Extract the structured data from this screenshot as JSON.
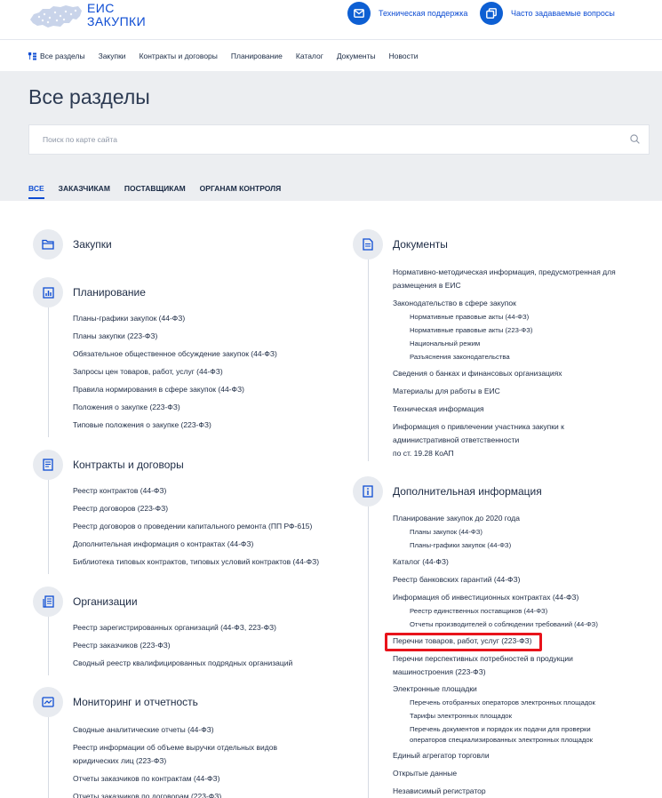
{
  "header": {
    "logo": [
      "ЕИС",
      "ЗАКУПКИ"
    ],
    "support_label": "Техническая поддержка",
    "faq_label": "Часто задаваемые вопросы"
  },
  "nav": [
    "Все разделы",
    "Закупки",
    "Контракты и договоры",
    "Планирование",
    "Каталог",
    "Документы",
    "Новости"
  ],
  "page_title": "Все разделы",
  "search": {
    "placeholder": "Поиск по карте сайта"
  },
  "tabs": [
    "ВСЕ",
    "ЗАКАЗЧИКАМ",
    "ПОСТАВЩИКАМ",
    "ОРГАНАМ КОНТРОЛЯ"
  ],
  "colors": {
    "accent": "#0d4cd3",
    "highlight": "#e8131b",
    "hero_bg": "#eceef1"
  },
  "left_sections": [
    {
      "title": "Закупки",
      "icon": "folder-icon",
      "items": []
    },
    {
      "title": "Планирование",
      "icon": "bar-chart-icon",
      "items": [
        {
          "text": "Планы-графики закупок (44-ФЗ)"
        },
        {
          "text": "Планы закупки (223-ФЗ)"
        },
        {
          "text": "Обязательное общественное обсуждение закупок (44-ФЗ)"
        },
        {
          "text": "Запросы цен товаров, работ, услуг (44-ФЗ)"
        },
        {
          "text": "Правила нормирования в сфере закупок (44-ФЗ)"
        },
        {
          "text": "Положения о закупке (223-ФЗ)"
        },
        {
          "text": "Типовые положения о закупке (223-ФЗ)"
        }
      ]
    },
    {
      "title": "Контракты и договоры",
      "icon": "document-icon",
      "items": [
        {
          "text": "Реестр контрактов (44-ФЗ)"
        },
        {
          "text": "Реестр договоров (223-ФЗ)"
        },
        {
          "text": "Реестр договоров о проведении капитального ремонта (ПП РФ-615)"
        },
        {
          "text": "Дополнительная информация о контрактах (44-ФЗ)"
        },
        {
          "text": "Библиотека типовых контрактов, типовых условий контрактов (44-ФЗ)"
        }
      ]
    },
    {
      "title": "Организации",
      "icon": "organization-icon",
      "items": [
        {
          "text": "Реестр зарегистрированных организаций (44-ФЗ, 223-ФЗ)"
        },
        {
          "text": "Реестр заказчиков (223-ФЗ)"
        },
        {
          "text": "Сводный реестр квалифицированных подрядных организаций"
        }
      ]
    },
    {
      "title": "Мониторинг и отчетность",
      "icon": "monitor-icon",
      "items": [
        {
          "text": "Сводные аналитические отчеты (44-ФЗ)"
        },
        {
          "text": "Реестр информации об объеме выручки отдельных видов"
        },
        {
          "text": "юридических лиц (223-ФЗ)",
          "cont": true
        },
        {
          "text": "Отчеты заказчиков по контрактам (44-ФЗ)"
        },
        {
          "text": "Отчеты заказчиков по договорам (223-ФЗ)"
        }
      ]
    }
  ],
  "right_sections": [
    {
      "title": "Документы",
      "icon": "file-icon",
      "items": [
        {
          "text": "Нормативно-методическая информация, предусмотренная для"
        },
        {
          "text": "размещения в ЕИС",
          "cont": true
        },
        {
          "text": "Законодательство в сфере закупок"
        },
        {
          "text": "Нормативные правовые акты (44-ФЗ)",
          "sub": true
        },
        {
          "text": "Нормативные правовые акты (223-ФЗ)",
          "sub": true
        },
        {
          "text": "Национальный режим",
          "sub": true
        },
        {
          "text": "Разъяснения законодательства",
          "sub": true
        },
        {
          "text": "Сведения о банках и финансовых организациях"
        },
        {
          "text": "Материалы для работы в ЕИС"
        },
        {
          "text": "Техническая информация"
        },
        {
          "text": "Информация о привлечении участника закупки к"
        },
        {
          "text": "административной ответственности",
          "cont": true
        },
        {
          "text": "по ст. 19.28 КоАП",
          "cont": true
        }
      ]
    },
    {
      "title": "Дополнительная информация",
      "icon": "info-icon",
      "items": [
        {
          "text": "Планирование закупок до 2020 года"
        },
        {
          "text": "Планы закупок (44-ФЗ)",
          "sub": true
        },
        {
          "text": "Планы-графики закупок (44-ФЗ)",
          "sub": true
        },
        {
          "text": "Каталог (44-ФЗ)"
        },
        {
          "text": "Реестр банковских гарантий (44-ФЗ)"
        },
        {
          "text": "Информация об инвестиционных контрактах (44-ФЗ)"
        },
        {
          "text": "Реестр единственных поставщиков (44-ФЗ)",
          "sub": true
        },
        {
          "text": "Отчеты производителей о соблюдении требований (44-ФЗ)",
          "sub": true
        },
        {
          "text": "Перечни товаров, работ, услуг (223-ФЗ)"
        },
        {
          "text": "Перечни перспективных потребностей в продукции"
        },
        {
          "text": "машиностроения (223-ФЗ)",
          "cont": true
        },
        {
          "text": "Электронные площадки"
        },
        {
          "text": "Перечень отобранных операторов электронных площадок",
          "sub": true
        },
        {
          "text": "Тарифы электронных площадок",
          "sub": true
        },
        {
          "text": "Перечень документов и порядок их подачи для проверки",
          "sub": true
        },
        {
          "text": "операторов специализированных электронных площадок",
          "sub": true,
          "cont": true
        },
        {
          "text": "Единый агрегатор торговли"
        },
        {
          "text": "Открытые данные"
        },
        {
          "text": "Независимый регистратор"
        }
      ]
    }
  ]
}
